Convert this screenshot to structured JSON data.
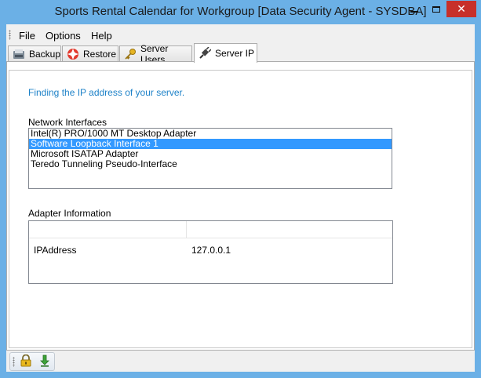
{
  "window": {
    "title": "Sports Rental Calendar for Workgroup [Data Security Agent - SYSDBA]",
    "minimize_glyph": "",
    "close_glyph": "✕"
  },
  "menu": {
    "items": [
      "File",
      "Options",
      "Help"
    ]
  },
  "tabs": [
    {
      "label": "Backup",
      "icon": "backup-icon"
    },
    {
      "label": "Restore",
      "icon": "lifebuoy-icon"
    },
    {
      "label": "Server Users",
      "icon": "key-icon"
    },
    {
      "label": "Server IP",
      "icon": "network-plug-icon",
      "active": true
    }
  ],
  "server_ip": {
    "hint": "Finding the IP address of your server.",
    "network_interfaces_label": "Network Interfaces",
    "network_interfaces": [
      "Intel(R) PRO/1000 MT Desktop Adapter",
      "Software Loopback Interface 1",
      "Microsoft ISATAP Adapter",
      "Teredo Tunneling Pseudo-Interface"
    ],
    "selected_interface": "Software Loopback Interface 1",
    "adapter_info_label": "Adapter Information",
    "adapter_info": {
      "headers": [
        "",
        ""
      ],
      "rows": [
        {
          "key": "IPAddress",
          "value": "127.0.0.1"
        }
      ]
    }
  },
  "statusbar": {
    "buttons": [
      "lock-icon",
      "download-arrow-icon"
    ]
  },
  "colors": {
    "title_bar": "#6bb0e6",
    "close_button": "#c7302a",
    "selection": "#3399ff",
    "hint_text": "#1e82c8"
  }
}
